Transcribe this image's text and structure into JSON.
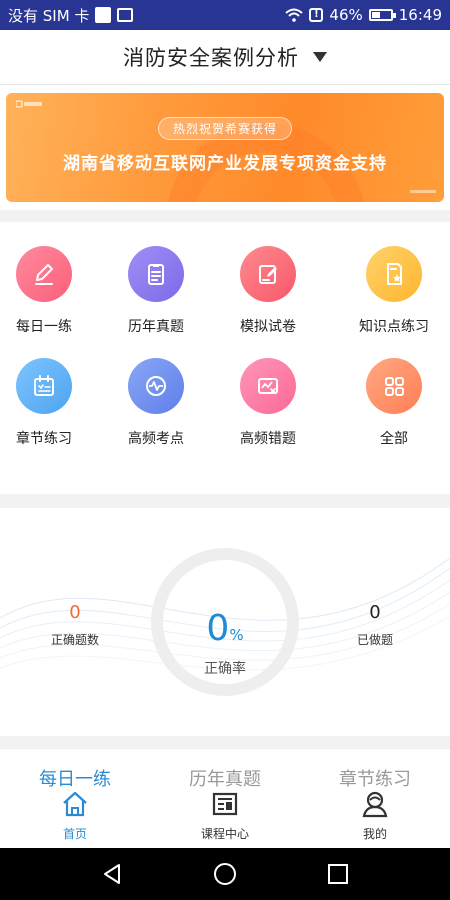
{
  "status_bar": {
    "carrier": "没有 SIM 卡",
    "battery": "46%",
    "battery_level": 0.46,
    "time": "16:49"
  },
  "header": {
    "title": "消防安全案例分析"
  },
  "banner": {
    "pill_text": "热烈祝贺希赛获得",
    "headline": "湖南省移动互联网产业发展专项资金支持"
  },
  "grid": {
    "items": [
      {
        "label": "每日一练",
        "icon": "pencil-icon",
        "color": "#ff6f8a"
      },
      {
        "label": "历年真题",
        "icon": "clipboard-icon",
        "color": "#8b7bf0"
      },
      {
        "label": "模拟试卷",
        "icon": "edit-paper-icon",
        "color": "#fb6d7c"
      },
      {
        "label": "知识点练习",
        "icon": "star-doc-icon",
        "color": "#ffc24a"
      },
      {
        "label": "章节练习",
        "icon": "calendar-check-icon",
        "color": "#5cb2f4"
      },
      {
        "label": "高频考点",
        "icon": "pulse-check-icon",
        "color": "#6e8ff1"
      },
      {
        "label": "高频错题",
        "icon": "error-chart-icon",
        "color": "#ff79a4"
      },
      {
        "label": "全部",
        "icon": "grid-four-icon",
        "color": "#ff8f68"
      }
    ]
  },
  "stats": {
    "correct_count": "0",
    "correct_count_label": "正确题数",
    "accuracy_value": "0",
    "accuracy_unit": "%",
    "accuracy_label": "正确率",
    "done_count": "0",
    "done_count_label": "已做题"
  },
  "peek_tabs": [
    {
      "label": "每日一练",
      "active": true
    },
    {
      "label": "历年真题",
      "active": false
    },
    {
      "label": "章节练习",
      "active": false
    }
  ],
  "bottom_nav": [
    {
      "label": "首页",
      "icon": "home-icon",
      "active": true
    },
    {
      "label": "课程中心",
      "icon": "course-icon",
      "active": false
    },
    {
      "label": "我的",
      "icon": "profile-icon",
      "active": false
    }
  ],
  "colors": {
    "accent": "#2a8bd1",
    "status_bar": "#283593",
    "banner": "#ff9a3c"
  }
}
